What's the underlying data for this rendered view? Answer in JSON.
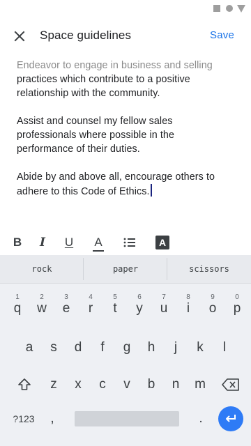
{
  "app_bar": {
    "title": "Space guidelines",
    "save_label": "Save"
  },
  "editor": {
    "paragraphs": [
      {
        "faded_line": "Endeavor to engage in business and selling",
        "text": "practices which contribute to a positive relationship with the community."
      },
      {
        "text": "Assist and counsel my fellow sales professionals where possible in the performance of their duties."
      },
      {
        "text": "Abide by and above all, encourage others to adhere to this Code of Ethics."
      }
    ]
  },
  "format_toolbar": {
    "bold": "B",
    "italic": "I",
    "underline": "U",
    "text_color": "A",
    "highlight": "A"
  },
  "keyboard": {
    "suggestions": [
      "rock",
      "paper",
      "scissors"
    ],
    "row1": [
      {
        "hint": "1",
        "key": "q"
      },
      {
        "hint": "2",
        "key": "w"
      },
      {
        "hint": "3",
        "key": "e"
      },
      {
        "hint": "4",
        "key": "r"
      },
      {
        "hint": "5",
        "key": "t"
      },
      {
        "hint": "6",
        "key": "y"
      },
      {
        "hint": "7",
        "key": "u"
      },
      {
        "hint": "8",
        "key": "i"
      },
      {
        "hint": "9",
        "key": "o"
      },
      {
        "hint": "0",
        "key": "p"
      }
    ],
    "row2": [
      "a",
      "s",
      "d",
      "f",
      "g",
      "h",
      "j",
      "k",
      "l"
    ],
    "row3": [
      "z",
      "x",
      "c",
      "v",
      "b",
      "n",
      "m"
    ],
    "symbols_key": "?123",
    "comma_key": ",",
    "period_key": "."
  },
  "colors": {
    "accent": "#1a73e8",
    "enter_key": "#2e7bf6",
    "keyboard_bg": "#eef0f4"
  }
}
